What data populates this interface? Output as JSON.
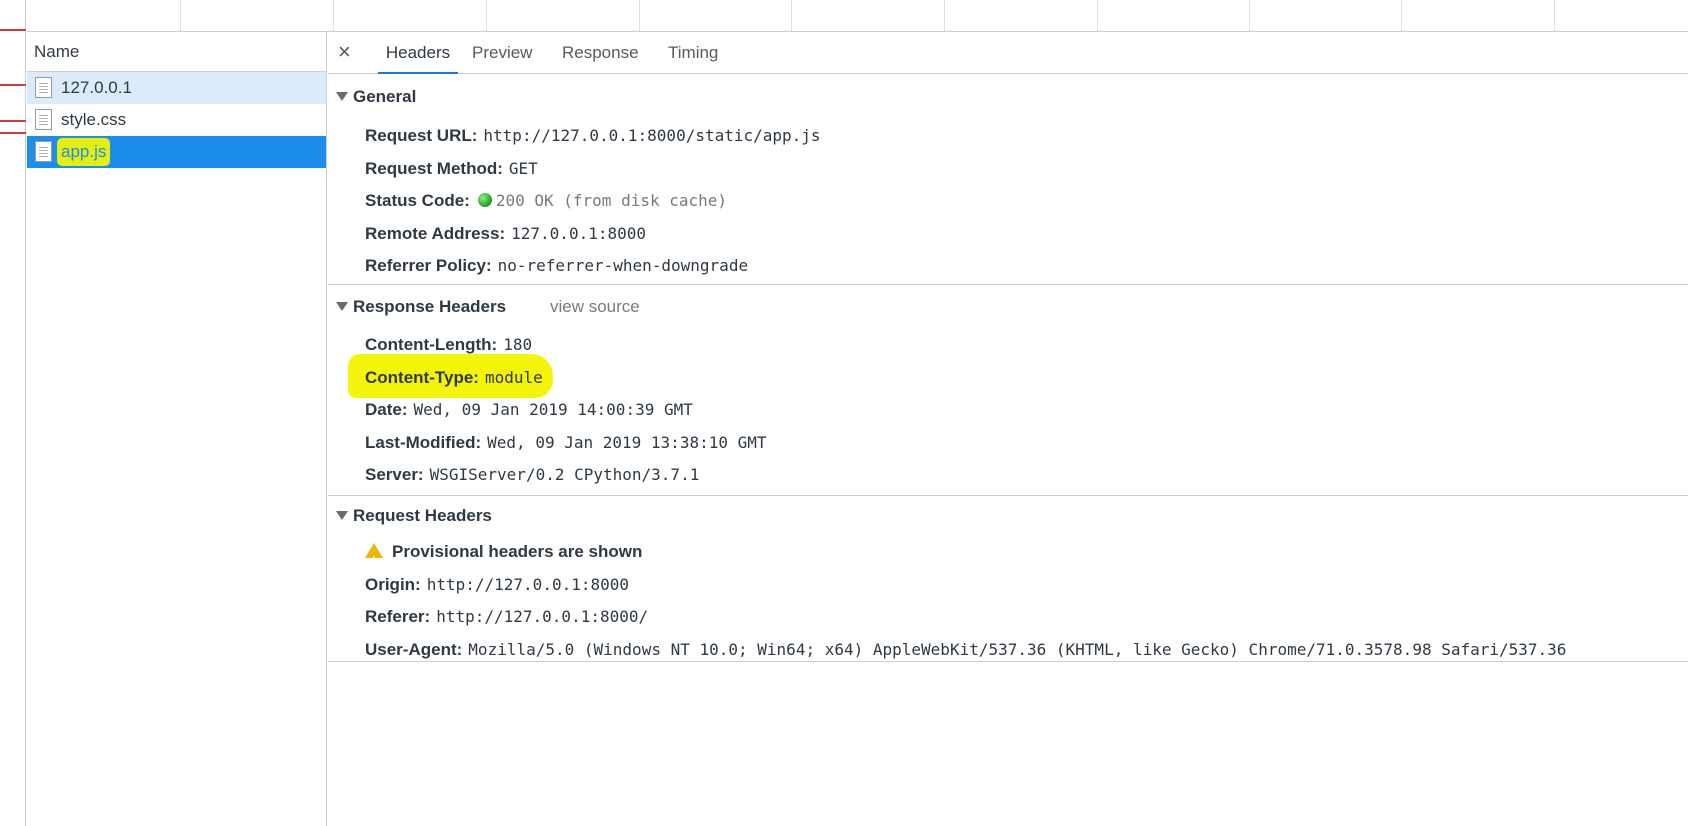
{
  "requests": {
    "column_header": "Name",
    "items": [
      {
        "name": "127.0.0.1"
      },
      {
        "name": "style.css"
      },
      {
        "name": "app.js"
      }
    ]
  },
  "tabs": {
    "close": "×",
    "items": [
      "Headers",
      "Preview",
      "Response",
      "Timing"
    ],
    "active": "Headers"
  },
  "general": {
    "title": "General",
    "request_url": {
      "key": "Request URL:",
      "value": "http://127.0.0.1:8000/static/app.js"
    },
    "request_method": {
      "key": "Request Method:",
      "value": "GET"
    },
    "status_code": {
      "key": "Status Code:",
      "value": "200 OK (from disk cache)"
    },
    "remote_address": {
      "key": "Remote Address:",
      "value": "127.0.0.1:8000"
    },
    "referrer_policy": {
      "key": "Referrer Policy:",
      "value": "no-referrer-when-downgrade"
    }
  },
  "response_headers": {
    "title": "Response Headers",
    "view_source": "view source",
    "content_length": {
      "key": "Content-Length:",
      "value": "180"
    },
    "content_type": {
      "key": "Content-Type:",
      "value": "module"
    },
    "date": {
      "key": "Date:",
      "value": "Wed, 09 Jan 2019 14:00:39 GMT"
    },
    "last_modified": {
      "key": "Last-Modified:",
      "value": "Wed, 09 Jan 2019 13:38:10 GMT"
    },
    "server": {
      "key": "Server:",
      "value": "WSGIServer/0.2 CPython/3.7.1"
    }
  },
  "request_headers": {
    "title": "Request Headers",
    "provisional": "Provisional headers are shown",
    "origin": {
      "key": "Origin:",
      "value": "http://127.0.0.1:8000"
    },
    "referer": {
      "key": "Referer:",
      "value": "http://127.0.0.1:8000/"
    },
    "user_agent": {
      "key": "User-Agent:",
      "value": "Mozilla/5.0 (Windows NT 10.0; Win64; x64) AppleWebKit/537.36 (KHTML, like Gecko) Chrome/71.0.3578.98 Safari/537.36"
    }
  },
  "colors": {
    "selected_row": "#1a8eea",
    "hover_row": "#dcebfb",
    "highlight": "#f4f40a",
    "status_ok": "#1e9b1e",
    "warning": "#e8b70a",
    "timeline_mark": "#d23a3a"
  },
  "icons": {
    "file": "document-icon",
    "status": "status-dot-icon",
    "warning": "warning-icon",
    "expand": "triangle-down-icon"
  }
}
